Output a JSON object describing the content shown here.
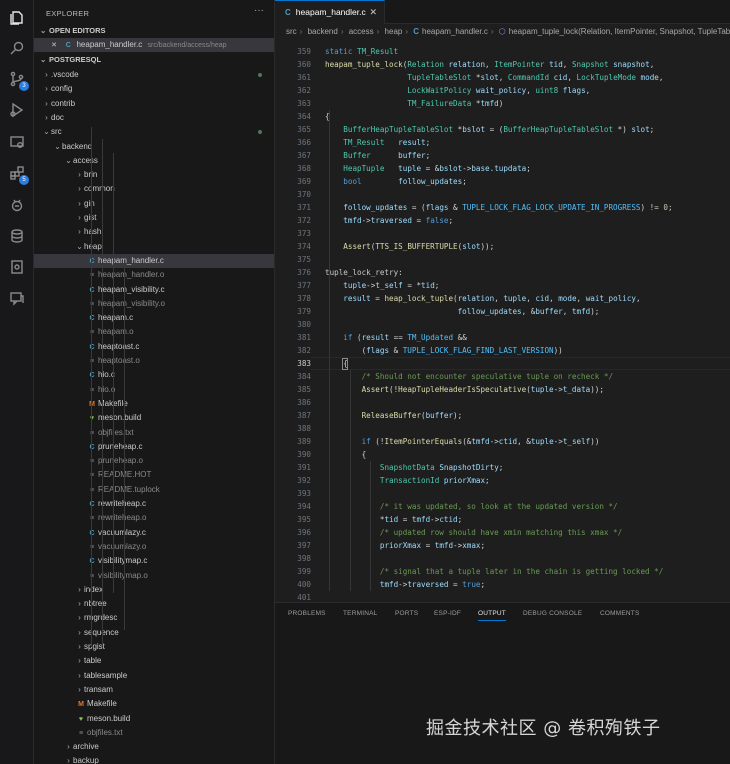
{
  "sidebar": {
    "title": "EXPLORER",
    "more": "···",
    "open_editors": {
      "header": "OPEN EDITORS",
      "items": [
        {
          "close": "✕",
          "icon": "C",
          "name": "heapam_handler.c",
          "path": "src/backend/access/heap"
        }
      ]
    },
    "project": {
      "header": "POSTGRESQL",
      "rows": [
        {
          "name": ".vscode",
          "chevron": "›",
          "dot": true
        },
        {
          "name": "config",
          "chevron": "›"
        },
        {
          "name": "contrib",
          "chevron": "›"
        },
        {
          "name": "doc",
          "chevron": "›"
        },
        {
          "name": "src",
          "chevron": "⌄",
          "dot": true
        },
        {
          "name": "backend",
          "chevron": "⌄"
        },
        {
          "name": "access",
          "chevron": "⌄"
        },
        {
          "name": "brin",
          "chevron": "›"
        },
        {
          "name": "common",
          "chevron": "›"
        },
        {
          "name": "gin",
          "chevron": "›"
        },
        {
          "name": "gist",
          "chevron": "›"
        },
        {
          "name": "hash",
          "chevron": "›"
        },
        {
          "name": "heap",
          "chevron": "⌄"
        },
        {
          "name": "heapam_handler.c",
          "icon": "C"
        },
        {
          "name": "heapam_handler.o",
          "icon": "≡"
        },
        {
          "name": "heapam_visibility.c",
          "icon": "C"
        },
        {
          "name": "heapam_visibility.o",
          "icon": "≡"
        },
        {
          "name": "heapam.c",
          "icon": "C"
        },
        {
          "name": "heapam.o",
          "icon": "≡"
        },
        {
          "name": "heaptoast.c",
          "icon": "C"
        },
        {
          "name": "heaptoast.o",
          "icon": "≡"
        },
        {
          "name": "hio.c",
          "icon": "C"
        },
        {
          "name": "hio.o",
          "icon": "≡"
        },
        {
          "name": "Makefile",
          "icon": "M"
        },
        {
          "name": "meson.build",
          "icon": "♥"
        },
        {
          "name": "objfiles.txt",
          "icon": "≡"
        },
        {
          "name": "pruneheap.c",
          "icon": "C"
        },
        {
          "name": "pruneheap.o",
          "icon": "≡"
        },
        {
          "name": "README.HOT",
          "icon": "≡"
        },
        {
          "name": "README.tuplock",
          "icon": "≡"
        },
        {
          "name": "rewriteheap.c",
          "icon": "C"
        },
        {
          "name": "rewriteheap.o",
          "icon": "≡"
        },
        {
          "name": "vacuumlazy.c",
          "icon": "C"
        },
        {
          "name": "vacuumlazy.o",
          "icon": "≡"
        },
        {
          "name": "visibilitymap.c",
          "icon": "C"
        },
        {
          "name": "visibilitymap.o",
          "icon": "≡"
        },
        {
          "name": "index",
          "chevron": "›"
        },
        {
          "name": "nbtree",
          "chevron": "›"
        },
        {
          "name": "rmgrdesc",
          "chevron": "›"
        },
        {
          "name": "sequence",
          "chevron": "›"
        },
        {
          "name": "spgist",
          "chevron": "›"
        },
        {
          "name": "table",
          "chevron": "›"
        },
        {
          "name": "tablesample",
          "chevron": "›"
        },
        {
          "name": "transam",
          "chevron": "›"
        },
        {
          "name": "Makefile",
          "icon": "M"
        },
        {
          "name": "meson.build",
          "icon": "♥"
        },
        {
          "name": "objfiles.txt",
          "icon": "≡"
        },
        {
          "name": "archive",
          "chevron": "›"
        },
        {
          "name": "backup",
          "chevron": "›"
        }
      ]
    }
  },
  "activity_bar": {
    "icons": [
      "files-icon",
      "search-icon",
      "source-control-icon",
      "run-debug-icon",
      "remote-explorer-icon",
      "extensions-icon",
      "esp-idf-icon",
      "database-icon",
      "device-icon",
      "comments-icon"
    ],
    "badges": {
      "source_control": "3",
      "extensions": "5"
    }
  },
  "editor": {
    "tab": {
      "icon": "C",
      "label": "heapam_handler.c",
      "close": "✕"
    },
    "breadcrumbs": [
      "src",
      "backend",
      "access",
      "heap",
      "heapam_handler.c",
      "heapam_tuple_lock(Relation, ItemPointer, Snapshot, TupleTableSlot *, CommandId, LockTupleMode, LockWaitPolicy, uint8, TM_FailureData *)"
    ],
    "current_line": 383,
    "lines": [
      {
        "n": 359,
        "t": "static TM_Result"
      },
      {
        "n": 360,
        "t": "heapam_tuple_lock(Relation relation, ItemPointer tid, Snapshot snapshot,"
      },
      {
        "n": 361,
        "t": "                  TupleTableSlot *slot, CommandId cid, LockTupleMode mode,"
      },
      {
        "n": 362,
        "t": "                  LockWaitPolicy wait_policy, uint8 flags,"
      },
      {
        "n": 363,
        "t": "                  TM_FailureData *tmfd)"
      },
      {
        "n": 364,
        "t": "{"
      },
      {
        "n": 365,
        "t": "    BufferHeapTupleTableSlot *bslot = (BufferHeapTupleTableSlot *) slot;"
      },
      {
        "n": 366,
        "t": "    TM_Result   result;"
      },
      {
        "n": 367,
        "t": "    Buffer      buffer;"
      },
      {
        "n": 368,
        "t": "    HeapTuple   tuple = &bslot->base.tupdata;"
      },
      {
        "n": 369,
        "t": "    bool        follow_updates;"
      },
      {
        "n": 370,
        "t": ""
      },
      {
        "n": 371,
        "t": "    follow_updates = (flags & TUPLE_LOCK_FLAG_LOCK_UPDATE_IN_PROGRESS) != 0;"
      },
      {
        "n": 372,
        "t": "    tmfd->traversed = false;"
      },
      {
        "n": 373,
        "t": ""
      },
      {
        "n": 374,
        "t": "    Assert(TTS_IS_BUFFERTUPLE(slot));"
      },
      {
        "n": 375,
        "t": ""
      },
      {
        "n": 376,
        "t": "tuple_lock_retry:"
      },
      {
        "n": 377,
        "t": "    tuple->t_self = *tid;"
      },
      {
        "n": 378,
        "t": "    result = heap_lock_tuple(relation, tuple, cid, mode, wait_policy,"
      },
      {
        "n": 379,
        "t": "                             follow_updates, &buffer, tmfd);"
      },
      {
        "n": 380,
        "t": ""
      },
      {
        "n": 381,
        "t": "    if (result == TM_Updated &&"
      },
      {
        "n": 382,
        "t": "        (flags & TUPLE_LOCK_FLAG_FIND_LAST_VERSION))"
      },
      {
        "n": 383,
        "t": "    {"
      },
      {
        "n": 384,
        "t": "        /* Should not encounter speculative tuple on recheck */"
      },
      {
        "n": 385,
        "t": "        Assert(!HeapTupleHeaderIsSpeculative(tuple->t_data));"
      },
      {
        "n": 386,
        "t": ""
      },
      {
        "n": 387,
        "t": "        ReleaseBuffer(buffer);"
      },
      {
        "n": 388,
        "t": ""
      },
      {
        "n": 389,
        "t": "        if (!ItemPointerEquals(&tmfd->ctid, &tuple->t_self))"
      },
      {
        "n": 390,
        "t": "        {"
      },
      {
        "n": 391,
        "t": "            SnapshotData SnapshotDirty;"
      },
      {
        "n": 392,
        "t": "            TransactionId priorXmax;"
      },
      {
        "n": 393,
        "t": ""
      },
      {
        "n": 394,
        "t": "            /* it was updated, so look at the updated version */"
      },
      {
        "n": 395,
        "t": "            *tid = tmfd->ctid;"
      },
      {
        "n": 396,
        "t": "            /* updated row should have xmin matching this xmax */"
      },
      {
        "n": 397,
        "t": "            priorXmax = tmfd->xmax;"
      },
      {
        "n": 398,
        "t": ""
      },
      {
        "n": 399,
        "t": "            /* signal that a tuple later in the chain is getting locked */"
      },
      {
        "n": 400,
        "t": "            tmfd->traversed = true;"
      },
      {
        "n": 401,
        "t": ""
      }
    ]
  },
  "panel": {
    "tabs": [
      "PROBLEMS",
      "TERMINAL",
      "PORTS",
      "ESP-IDF",
      "OUTPUT",
      "DEBUG CONSOLE",
      "COMMENTS"
    ],
    "active_tab": "OUTPUT"
  },
  "watermark": "掘金技术社区 @ 卷积殉铁子",
  "colors": {
    "editor_bg": "#1e1e1e",
    "sidebar_bg": "#181818",
    "accent": "#0078d4",
    "keyword": "#569cd6",
    "type": "#4ec9b0",
    "function": "#dcdcaa",
    "parameter": "#9cdcfe",
    "macro": "#4fc1ff",
    "comment": "#6a9955"
  }
}
